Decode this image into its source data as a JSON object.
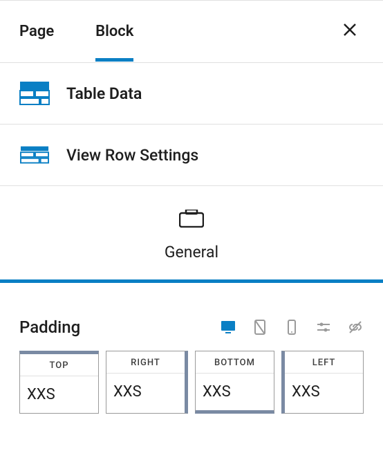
{
  "tabs": {
    "page": "Page",
    "block": "Block"
  },
  "sections": {
    "table_data": {
      "label": "Table Data",
      "icon": "table-icon"
    },
    "view_row": {
      "label": "View Row Settings",
      "icon": "row-icon"
    }
  },
  "general": {
    "label": "General",
    "icon": "box-icon"
  },
  "padding": {
    "title": "Padding",
    "devices": {
      "desktop": {
        "icon": "desktop-icon",
        "active": true
      },
      "tablet": {
        "icon": "tablet-icon",
        "active": false
      },
      "mobile": {
        "icon": "mobile-icon",
        "active": false
      },
      "sliders": {
        "icon": "sliders-icon"
      },
      "link": {
        "icon": "link-icon"
      }
    },
    "sides": {
      "top": {
        "label": "TOP",
        "value": "XXS"
      },
      "right": {
        "label": "RIGHT",
        "value": "XXS"
      },
      "bottom": {
        "label": "BOTTOM",
        "value": "XXS"
      },
      "left": {
        "label": "LEFT",
        "value": "XXS"
      }
    }
  },
  "colors": {
    "accent": "#0a7fc4",
    "muted_blue": "#7a8aa3"
  }
}
